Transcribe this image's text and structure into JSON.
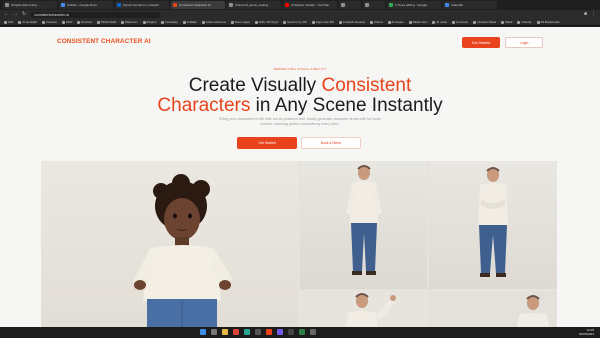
{
  "browser": {
    "tabs": [
      {
        "label": "Outputs disk timing - ...",
        "color": "#8f8f8f",
        "active": false
      },
      {
        "label": "Articles - Google Docs",
        "color": "#4a8af4",
        "active": false
      },
      {
        "label": "Syncer Kernel v1 | Linkedin",
        "color": "#0a66c2",
        "active": false
      },
      {
        "label": "Consistent Character AI",
        "color": "#e8431c",
        "active": true
      },
      {
        "label": "Clonus AI_demo_making",
        "color": "#8f8f8f",
        "active": false
      },
      {
        "label": "Character models - YouTube",
        "color": "#ff0000",
        "active": false
      },
      {
        "label": "",
        "color": "#8f8f8f",
        "active": false
      },
      {
        "label": "",
        "color": "#8f8f8f",
        "active": false
      },
      {
        "label": "3 Trees editing - Google",
        "color": "#34a853",
        "active": false
      },
      {
        "label": "Calendar",
        "color": "#4285f4",
        "active": false
      }
    ],
    "url": "consistentcharacter.ai",
    "bookmarks": [
      "Gifs",
      "AI spotlight",
      "Finance",
      "CEO",
      "Ezuccel",
      "Tiktok Draft",
      "Webconv",
      "Plugins",
      "buresetty",
      "Collabs",
      "Artist reference",
      "Dev+ Apps",
      "GW+ RP Apps",
      "Need to try RP",
      "Apps Can RP",
      "LinkedIn Review",
      "iCloud",
      "AI issues",
      "Slides Gen",
      "AI news",
      "Commun",
      "Linkedin Stats",
      "Slack",
      "Ghostly",
      "All Bookmarks"
    ]
  },
  "site": {
    "logo": "CONSISTENT CHARACTER AI",
    "header_start": "Get Started",
    "header_login": "Login",
    "eyebrow": "PERFECTING VISUAL FIDELITY",
    "headline_part1": "Create Visually ",
    "headline_accent1": "Consistent",
    "headline_accent2": "Characters",
    "headline_part2": " in Any Scene Instantly",
    "subtext": "Bring your characters to life with our AI-powered tool. Easily generate character shots with full pose control, ensuring perfect consistency every time.",
    "cta_start": "Get Started",
    "cta_demo": "Book a Demo",
    "accent_color": "#e8431c"
  },
  "taskbar": {
    "weather": "",
    "time": "12:05",
    "date": "09/05/2024"
  }
}
